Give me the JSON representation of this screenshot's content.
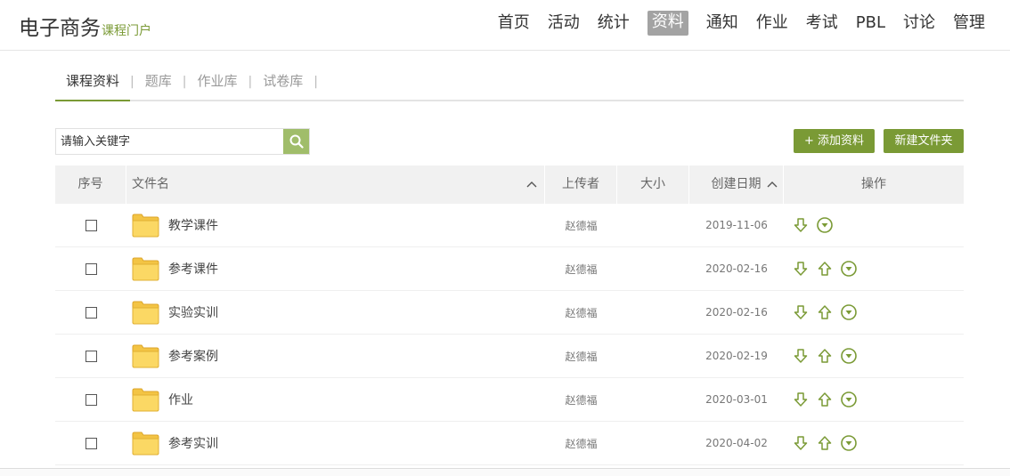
{
  "logo": {
    "main": "电子商务",
    "sub": "课程门户"
  },
  "nav": [
    {
      "label": "首页"
    },
    {
      "label": "活动"
    },
    {
      "label": "统计"
    },
    {
      "label": "资料",
      "active": true
    },
    {
      "label": "通知"
    },
    {
      "label": "作业"
    },
    {
      "label": "考试"
    },
    {
      "label": "PBL"
    },
    {
      "label": "讨论"
    },
    {
      "label": "管理"
    }
  ],
  "tabs": [
    {
      "label": "课程资料",
      "active": true
    },
    {
      "label": "题库"
    },
    {
      "label": "作业库"
    },
    {
      "label": "试卷库"
    }
  ],
  "tab_separator": "|",
  "search": {
    "placeholder": "请输入关键字"
  },
  "actions": {
    "add_label": "+ 添加资料",
    "new_folder_label": "新建文件夹"
  },
  "table": {
    "headers": {
      "index": "序号",
      "name": "文件名",
      "uploader": "上传者",
      "size": "大小",
      "created": "创建日期",
      "ops": "操作"
    },
    "sort_glyph": "^",
    "rows": [
      {
        "name": "教学课件",
        "uploader": "赵德福",
        "size": "",
        "date": "2019-11-06",
        "has_up": false
      },
      {
        "name": "参考课件",
        "uploader": "赵德福",
        "size": "",
        "date": "2020-02-16",
        "has_up": true
      },
      {
        "name": "实验实训",
        "uploader": "赵德福",
        "size": "",
        "date": "2020-02-16",
        "has_up": true
      },
      {
        "name": "参考案例",
        "uploader": "赵德福",
        "size": "",
        "date": "2020-02-19",
        "has_up": true
      },
      {
        "name": "作业",
        "uploader": "赵德福",
        "size": "",
        "date": "2020-03-01",
        "has_up": true
      },
      {
        "name": "参考实训",
        "uploader": "赵德福",
        "size": "",
        "date": "2020-04-02",
        "has_up": true
      }
    ]
  },
  "colors": {
    "accent": "#7a9a35",
    "search_btn": "#a0bd6a",
    "nav_active_bg": "#a3a3a3",
    "folder": "#f5c94a"
  },
  "icons": {
    "search": "search-icon",
    "folder": "folder-icon",
    "down": "arrow-down-icon",
    "up": "arrow-up-icon",
    "more": "chevron-circle-down-icon"
  }
}
